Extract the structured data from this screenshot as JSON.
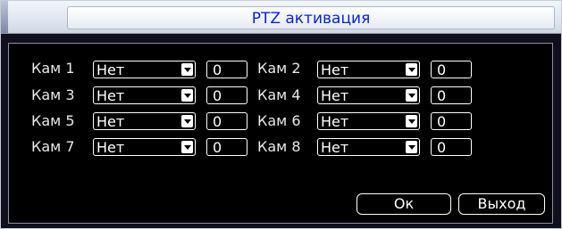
{
  "dialog": {
    "title": "PTZ активация"
  },
  "cameras": [
    {
      "label": "Кам 1",
      "mode": "Нет",
      "value": "0"
    },
    {
      "label": "Кам 2",
      "mode": "Нет",
      "value": "0"
    },
    {
      "label": "Кам 3",
      "mode": "Нет",
      "value": "0"
    },
    {
      "label": "Кам 4",
      "mode": "Нет",
      "value": "0"
    },
    {
      "label": "Кам 5",
      "mode": "Нет",
      "value": "0"
    },
    {
      "label": "Кам 6",
      "mode": "Нет",
      "value": "0"
    },
    {
      "label": "Кам 7",
      "mode": "Нет",
      "value": "0"
    },
    {
      "label": "Кам 8",
      "mode": "Нет",
      "value": "0"
    }
  ],
  "buttons": {
    "ok": "Ок",
    "exit": "Выход"
  },
  "colors": {
    "title_text": "#0a22d8",
    "panel_bg": "#000000",
    "text": "#ffffff"
  },
  "icons": {
    "dropdown": "chevron-down-icon"
  }
}
